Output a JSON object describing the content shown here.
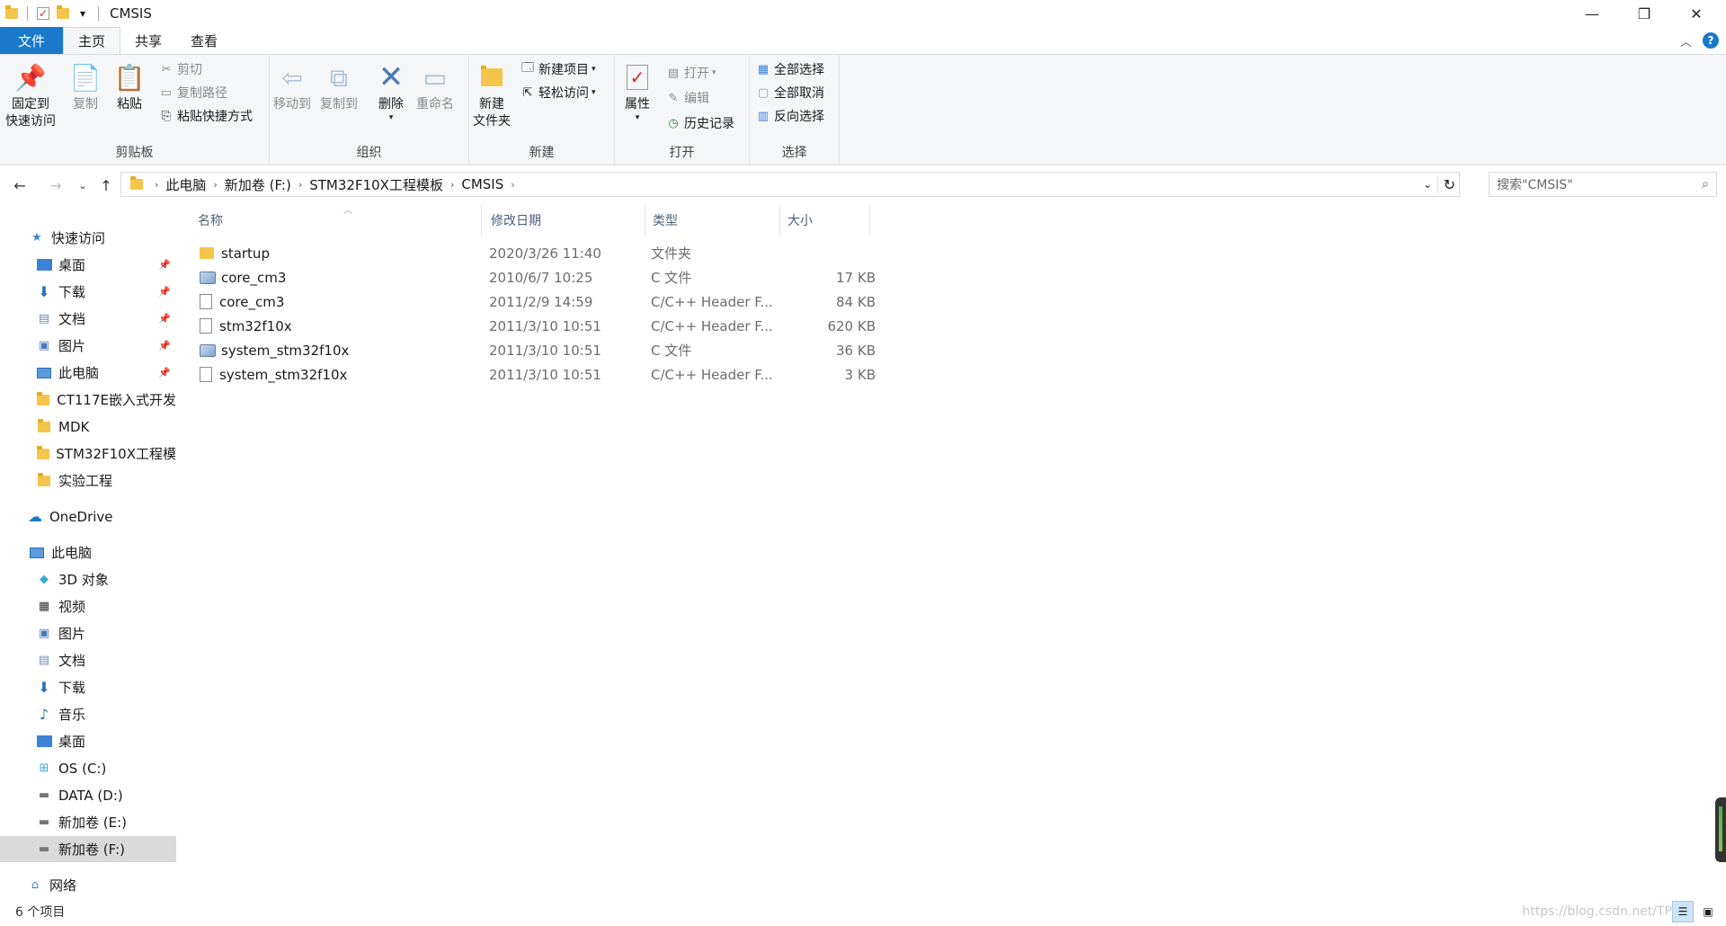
{
  "window": {
    "title": "CMSIS",
    "quick_access_dropdown": "▾",
    "minimize": "—",
    "maximize": "❐",
    "close": "✕"
  },
  "ribbon_tabs": [
    "文件",
    "主页",
    "共享",
    "查看"
  ],
  "ribbon": {
    "clipboard": {
      "label": "剪贴板",
      "pin": "固定到",
      "pin2": "快速访问",
      "copy": "复制",
      "paste": "粘贴",
      "cut": "剪切",
      "copy_path": "复制路径",
      "paste_shortcut": "粘贴快捷方式"
    },
    "organize": {
      "label": "组织",
      "move_to": "移动到",
      "copy_to": "复制到",
      "delete": "删除",
      "rename": "重命名"
    },
    "new": {
      "label": "新建",
      "new_folder": "新建",
      "new_folder2": "文件夹",
      "new_item": "新建项目",
      "easy_access": "轻松访问"
    },
    "open": {
      "label": "打开",
      "properties": "属性",
      "open": "打开",
      "edit": "编辑",
      "history": "历史记录"
    },
    "select": {
      "label": "选择",
      "select_all": "全部选择",
      "select_none": "全部取消",
      "invert": "反向选择"
    }
  },
  "address": {
    "crumbs": [
      "此电脑",
      "新加卷 (F:)",
      "STM32F10X工程模板",
      "CMSIS"
    ],
    "search_placeholder": "搜索\"CMSIS\""
  },
  "nav": {
    "quick_access": "快速访问",
    "qa_items": [
      "桌面",
      "下载",
      "文档",
      "图片",
      "此电脑",
      "CT117E嵌入式开发",
      "MDK",
      "STM32F10X工程模",
      "实验工程"
    ],
    "onedrive": "OneDrive",
    "this_pc": "此电脑",
    "pc_items": [
      "3D 对象",
      "视频",
      "图片",
      "文档",
      "下载",
      "音乐",
      "桌面",
      "OS (C:)",
      "DATA (D:)",
      "新加卷 (E:)",
      "新加卷 (F:)"
    ],
    "network": "网络"
  },
  "columns": {
    "name": "名称",
    "modified": "修改日期",
    "type": "类型",
    "size": "大小"
  },
  "files": [
    {
      "name": "startup",
      "modified": "2020/3/26 11:40",
      "type": "文件夹",
      "size": "",
      "icon": "folder"
    },
    {
      "name": "core_cm3",
      "modified": "2010/6/7 10:25",
      "type": "C 文件",
      "size": "17 KB",
      "icon": "c-file"
    },
    {
      "name": "core_cm3",
      "modified": "2011/2/9 14:59",
      "type": "C/C++ Header F...",
      "size": "84 KB",
      "icon": "h-file"
    },
    {
      "name": "stm32f10x",
      "modified": "2011/3/10 10:51",
      "type": "C/C++ Header F...",
      "size": "620 KB",
      "icon": "h-file"
    },
    {
      "name": "system_stm32f10x",
      "modified": "2011/3/10 10:51",
      "type": "C 文件",
      "size": "36 KB",
      "icon": "c-file"
    },
    {
      "name": "system_stm32f10x",
      "modified": "2011/3/10 10:51",
      "type": "C/C++ Header F...",
      "size": "3 KB",
      "icon": "h-file"
    }
  ],
  "status": {
    "count": "6 个项目",
    "watermark": "https://blog.csdn.net/TP"
  },
  "colors": {
    "file_tab": "#1979ca",
    "ribbon_bg": "#f5f6f7",
    "header_text": "#4c607a",
    "selected_nav": "#d9d9d9"
  }
}
